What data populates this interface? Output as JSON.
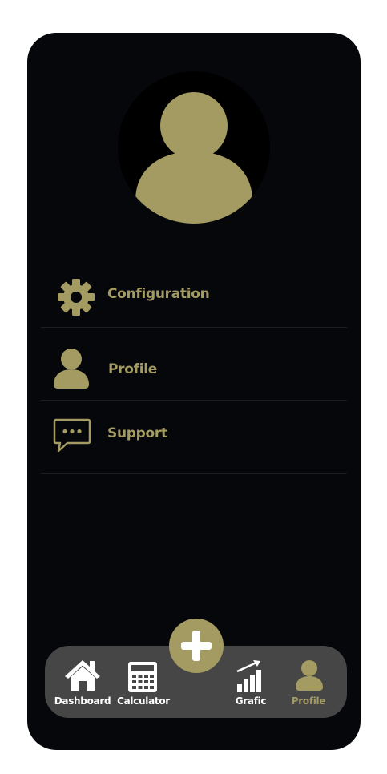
{
  "menu": {
    "items": [
      {
        "label": "Configuration",
        "icon": "gear-icon"
      },
      {
        "label": "Profile",
        "icon": "user-icon"
      },
      {
        "label": "Support",
        "icon": "chat-bubble-icon"
      }
    ]
  },
  "nav": {
    "items": [
      {
        "label": "Dashboard",
        "icon": "home-icon",
        "active": false
      },
      {
        "label": "Calculator",
        "icon": "calculator-icon",
        "active": false
      },
      {
        "label": "Grafic",
        "icon": "bar-chart-icon",
        "active": false
      },
      {
        "label": "Profile",
        "icon": "user-icon",
        "active": true
      }
    ],
    "fab_icon": "plus-icon"
  },
  "colors": {
    "accent": "#a39b61",
    "background": "#06070b",
    "navbar": "#464646",
    "nav_text": "#ffffff"
  }
}
